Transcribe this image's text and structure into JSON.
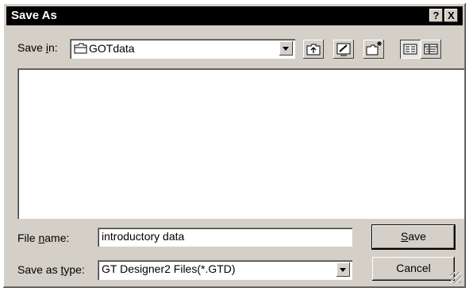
{
  "window": {
    "title": "Save As",
    "help_label": "?",
    "close_label": "X"
  },
  "savein": {
    "label_pre": "Save ",
    "label_key": "i",
    "label_post": "n:",
    "value": "GOTdata"
  },
  "toolbar": {
    "buttons": [
      {
        "name": "up-one-level-button",
        "icon": "up-folder-icon"
      },
      {
        "name": "desktop-button",
        "icon": "desktop-icon"
      },
      {
        "name": "new-folder-button",
        "icon": "new-folder-icon"
      },
      {
        "name": "list-view-button",
        "icon": "list-view-icon"
      },
      {
        "name": "details-view-button",
        "icon": "details-view-icon"
      }
    ]
  },
  "filename": {
    "label_pre": "File ",
    "label_key": "n",
    "label_post": "ame:",
    "value": "introductory data"
  },
  "savetype": {
    "label_pre": "Save as ",
    "label_key": "t",
    "label_post": "ype:",
    "value": "GT Designer2 Files(*.GTD)"
  },
  "buttons": {
    "save_key": "S",
    "save_rest": "ave",
    "cancel": "Cancel"
  }
}
